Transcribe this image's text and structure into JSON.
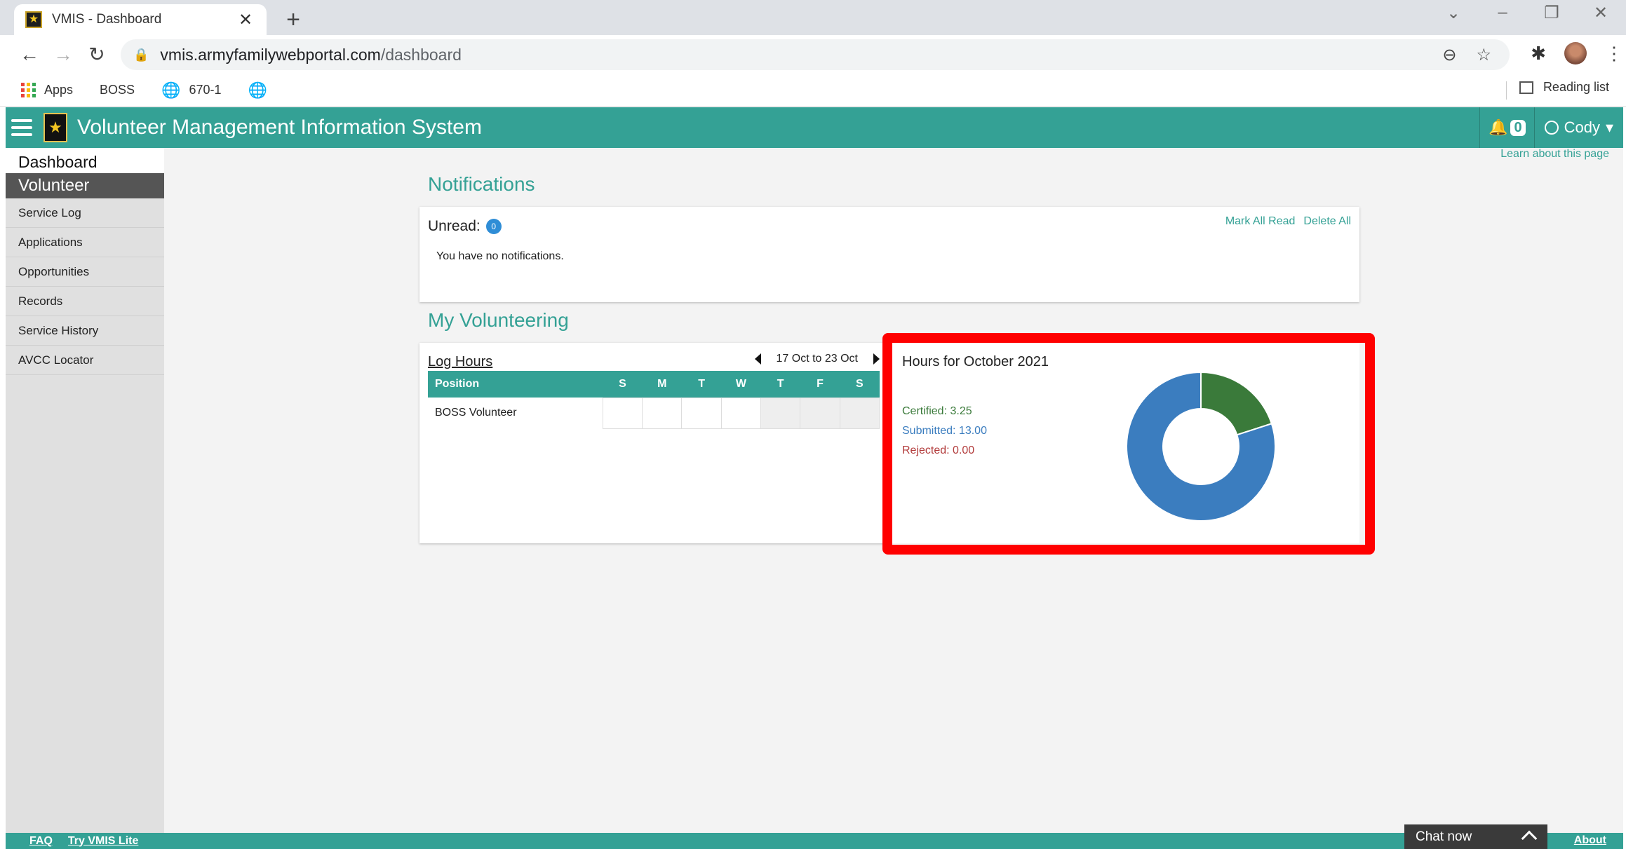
{
  "browser": {
    "tab_title": "VMIS - Dashboard",
    "url_host": "vmis.armyfamilywebportal.com",
    "url_path": "/dashboard",
    "bookmarks": [
      "Apps",
      "BOSS",
      "670-1"
    ],
    "reading_list": "Reading list"
  },
  "header": {
    "title": "Volunteer Management Information System",
    "notif_count": "0",
    "user": "Cody"
  },
  "sidebar": {
    "dashboard": "Dashboard",
    "section": "Volunteer",
    "items": [
      {
        "label": "Service Log"
      },
      {
        "label": "Applications"
      },
      {
        "label": "Opportunities"
      },
      {
        "label": "Records"
      },
      {
        "label": "Service History"
      },
      {
        "label": "AVCC Locator"
      }
    ]
  },
  "main": {
    "learn_link": "Learn about this page",
    "notifications": {
      "title": "Notifications",
      "unread_label": "Unread:",
      "unread_count": "0",
      "mark_all_read": "Mark All Read",
      "delete_all": "Delete All",
      "empty_text": "You have no notifications."
    },
    "volunteering": {
      "title": "My Volunteering",
      "log_hours": {
        "title": "Log Hours",
        "week_range": "17 Oct to 23 Oct",
        "position_header": "Position",
        "days": [
          "S",
          "M",
          "T",
          "W",
          "T",
          "F",
          "S"
        ],
        "rows": [
          {
            "position": "BOSS Volunteer"
          }
        ]
      },
      "hours": {
        "title": "Hours for October 2021",
        "certified_label": "Certified: 3.25",
        "submitted_label": "Submitted: 13.00",
        "rejected_label": "Rejected: 0.00"
      }
    }
  },
  "chart_data": {
    "type": "pie",
    "title": "Hours for October 2021",
    "categories": [
      "Certified",
      "Submitted",
      "Rejected"
    ],
    "values": [
      3.25,
      13.0,
      0.0
    ],
    "colors": [
      "#3a7a3a",
      "#3b7dbf",
      "#b23b3b"
    ]
  },
  "colors": {
    "brand_teal": "#34a195",
    "highlight_red": "#ff0000"
  },
  "footer": {
    "faq": "FAQ",
    "lite": "Try VMIS Lite",
    "chat": "Chat now",
    "about": "About"
  }
}
